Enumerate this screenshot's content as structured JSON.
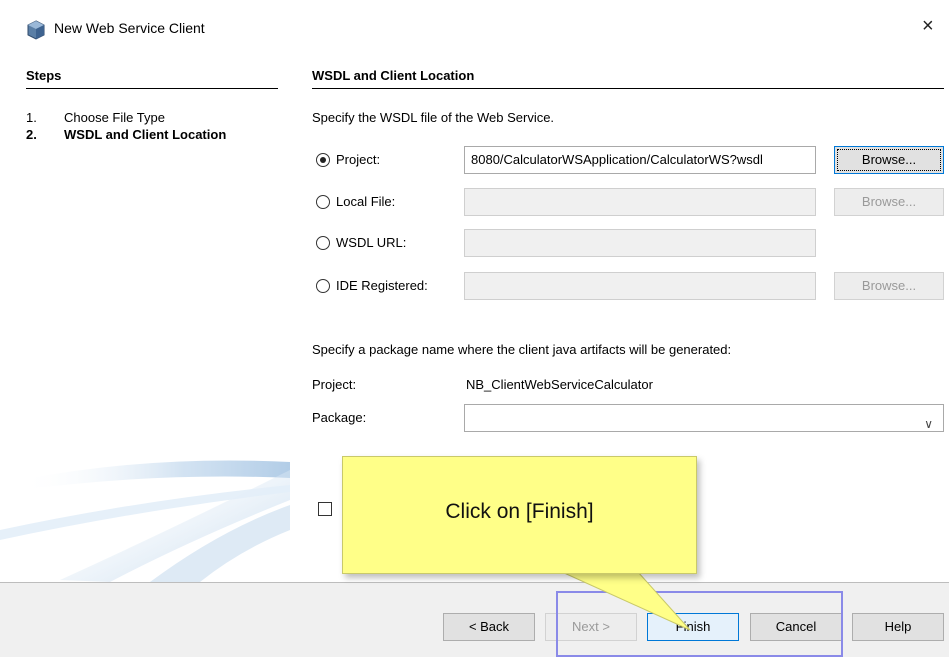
{
  "window": {
    "title": "New Web Service Client",
    "close_glyph": "×",
    "icon": "netbeans-cube-icon"
  },
  "steps": {
    "heading": "Steps",
    "items": [
      {
        "num": "1.",
        "label": "Choose File Type",
        "current": false
      },
      {
        "num": "2.",
        "label": "WSDL and Client Location",
        "current": true
      }
    ]
  },
  "main": {
    "heading": "WSDL and Client Location",
    "wsdl_prompt": "Specify the WSDL file of the Web Service.",
    "sources": [
      {
        "label": "Project:",
        "selected": true,
        "value": "8080/CalculatorWSApplication/CalculatorWS?wsdl",
        "browse": "Browse...",
        "browse_enabled": true,
        "field_enabled": true
      },
      {
        "label": "Local File:",
        "selected": false,
        "value": "",
        "browse": "Browse...",
        "browse_enabled": false,
        "field_enabled": false
      },
      {
        "label": "WSDL URL:",
        "selected": false,
        "value": "",
        "field_enabled": false
      },
      {
        "label": "IDE Registered:",
        "selected": false,
        "value": "",
        "browse": "Browse...",
        "browse_enabled": false,
        "field_enabled": false
      }
    ],
    "package_prompt": "Specify a package name where the client java artifacts will be generated:",
    "project_label": "Project:",
    "project_value": "NB_ClientWebServiceCalculator",
    "package_label": "Package:",
    "package_value": "",
    "dropdown_glyph": "∨"
  },
  "callout": {
    "text": "Click on [Finish]"
  },
  "footer": {
    "back": "< Back",
    "next": "Next >",
    "finish": "Finish",
    "cancel": "Cancel",
    "help": "Help"
  },
  "colors": {
    "callout_fill": "#ffff88",
    "highlight_border": "#8a8ae8",
    "focus_blue": "#0078d7"
  }
}
